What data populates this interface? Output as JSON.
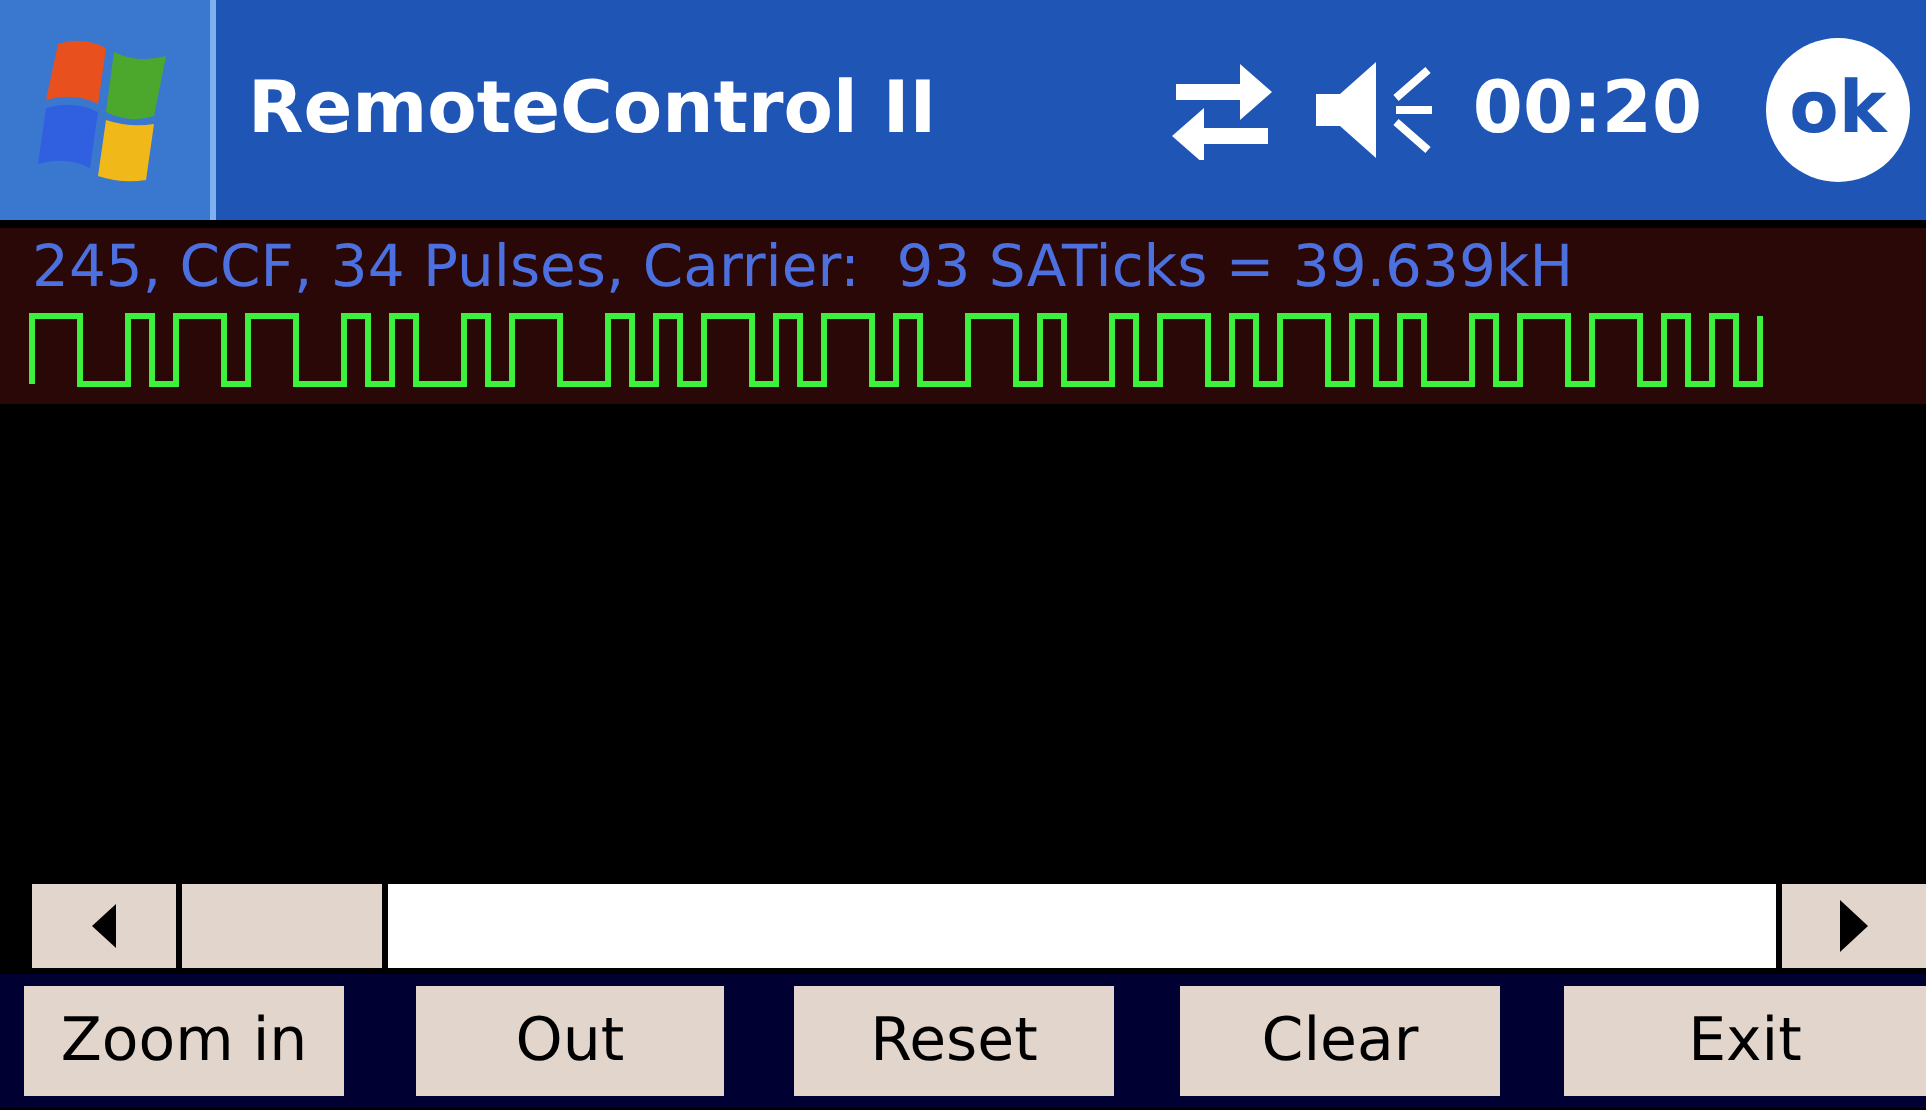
{
  "title_bar": {
    "title": "RemoteControl II",
    "time": "00:20",
    "ok_label": "ok"
  },
  "signal": {
    "info": "245, CCF, 34 Pulses, Carrier:  93 SATicks = 39.639kH"
  },
  "buttons": [
    {
      "label": "Zoom in"
    },
    {
      "label": "Out"
    },
    {
      "label": "Reset"
    },
    {
      "label": "Clear"
    },
    {
      "label": "Exit"
    }
  ]
}
